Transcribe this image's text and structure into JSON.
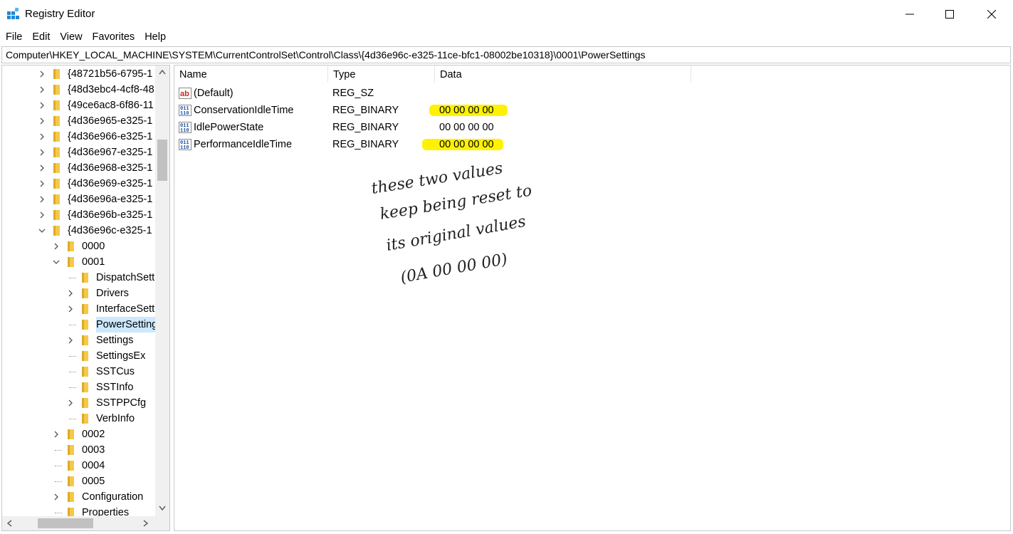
{
  "window": {
    "title": "Registry Editor"
  },
  "menu": [
    "File",
    "Edit",
    "View",
    "Favorites",
    "Help"
  ],
  "address": "Computer\\HKEY_LOCAL_MACHINE\\SYSTEM\\CurrentControlSet\\Control\\Class\\{4d36e96c-e325-11ce-bfc1-08002be10318}\\0001\\PowerSettings",
  "tree": [
    {
      "label": "{48721b56-6795-1",
      "level": 0,
      "chevron": "right"
    },
    {
      "label": "{48d3ebc4-4cf8-48",
      "level": 0,
      "chevron": "right"
    },
    {
      "label": "{49ce6ac8-6f86-11",
      "level": 0,
      "chevron": "right"
    },
    {
      "label": "{4d36e965-e325-1",
      "level": 0,
      "chevron": "right"
    },
    {
      "label": "{4d36e966-e325-1",
      "level": 0,
      "chevron": "right"
    },
    {
      "label": "{4d36e967-e325-1",
      "level": 0,
      "chevron": "right"
    },
    {
      "label": "{4d36e968-e325-1",
      "level": 0,
      "chevron": "right"
    },
    {
      "label": "{4d36e969-e325-1",
      "level": 0,
      "chevron": "right"
    },
    {
      "label": "{4d36e96a-e325-1",
      "level": 0,
      "chevron": "right"
    },
    {
      "label": "{4d36e96b-e325-1",
      "level": 0,
      "chevron": "right"
    },
    {
      "label": "{4d36e96c-e325-1",
      "level": 0,
      "chevron": "down"
    },
    {
      "label": "0000",
      "level": 1,
      "chevron": "right"
    },
    {
      "label": "0001",
      "level": 1,
      "chevron": "down"
    },
    {
      "label": "DispatchSett",
      "level": 2,
      "chevron": "none"
    },
    {
      "label": "Drivers",
      "level": 2,
      "chevron": "right"
    },
    {
      "label": "InterfaceSett",
      "level": 2,
      "chevron": "right"
    },
    {
      "label": "PowerSetting",
      "level": 2,
      "chevron": "none",
      "selected": true
    },
    {
      "label": "Settings",
      "level": 2,
      "chevron": "right"
    },
    {
      "label": "SettingsEx",
      "level": 2,
      "chevron": "none"
    },
    {
      "label": "SSTCus",
      "level": 2,
      "chevron": "none"
    },
    {
      "label": "SSTInfo",
      "level": 2,
      "chevron": "none"
    },
    {
      "label": "SSTPPCfg",
      "level": 2,
      "chevron": "right"
    },
    {
      "label": "VerbInfo",
      "level": 2,
      "chevron": "none"
    },
    {
      "label": "0002",
      "level": 1,
      "chevron": "right"
    },
    {
      "label": "0003",
      "level": 1,
      "chevron": "none"
    },
    {
      "label": "0004",
      "level": 1,
      "chevron": "none"
    },
    {
      "label": "0005",
      "level": 1,
      "chevron": "none"
    },
    {
      "label": "Configuration",
      "level": 1,
      "chevron": "right"
    },
    {
      "label": "Properties",
      "level": 1,
      "chevron": "none"
    }
  ],
  "columns": {
    "name": "Name",
    "type": "Type",
    "data": "Data"
  },
  "values": [
    {
      "name": "(Default)",
      "type": "REG_SZ",
      "data": "",
      "icon": "string-value-icon",
      "highlighted": false
    },
    {
      "name": "ConservationIdleTime",
      "type": "REG_BINARY",
      "data": "00 00 00 00",
      "icon": "binary-value-icon",
      "highlighted": true
    },
    {
      "name": "IdlePowerState",
      "type": "REG_BINARY",
      "data": "00 00 00 00",
      "icon": "binary-value-icon",
      "highlighted": false
    },
    {
      "name": "PerformanceIdleTime",
      "type": "REG_BINARY",
      "data": "00 00 00 00",
      "icon": "binary-value-icon",
      "highlighted": true
    }
  ],
  "annotation": {
    "lines": [
      "these two values",
      "keep being reset to",
      "its original values",
      "(0A 00 00 00)"
    ],
    "color": "#222222"
  },
  "colors": {
    "highlight": "#fff200",
    "selection": "#cce8ff",
    "folder": "#f3c94a"
  }
}
